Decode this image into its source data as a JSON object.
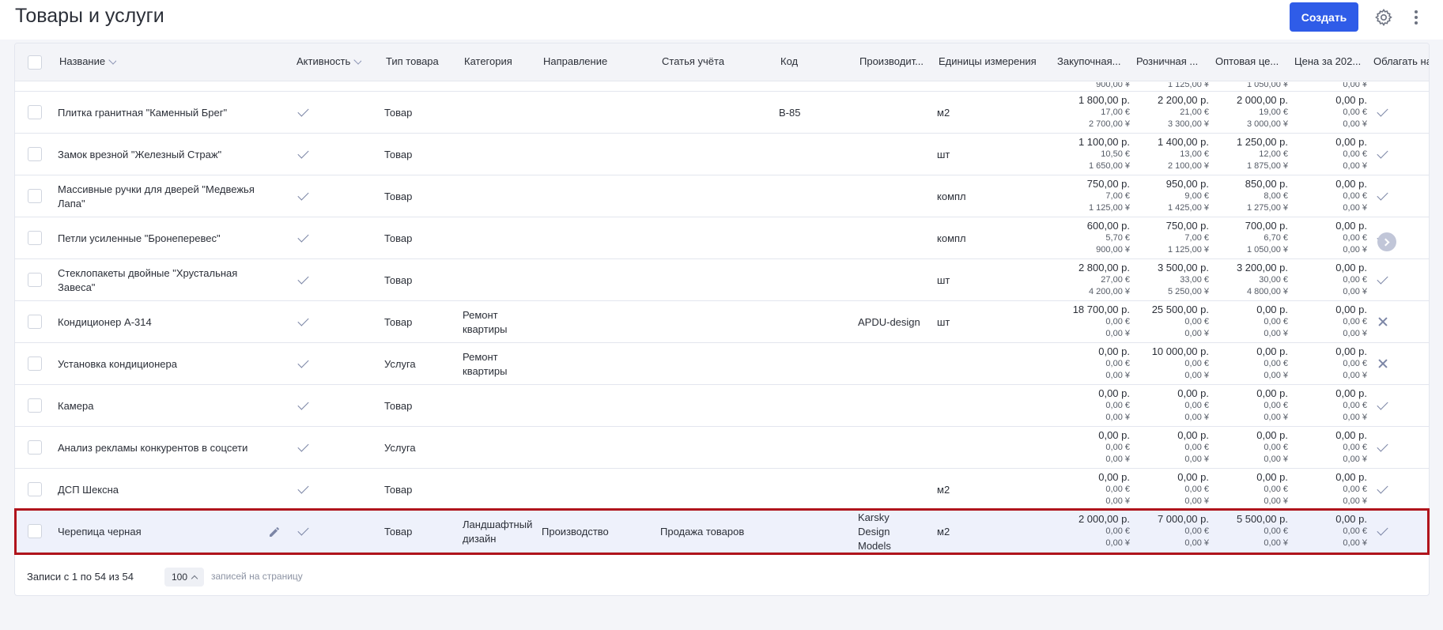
{
  "header": {
    "title": "Товары и услуги",
    "create_label": "Создать"
  },
  "table": {
    "columns": [
      "Название",
      "Активность",
      "Тип товара",
      "Категория",
      "Направление",
      "Статья учёта",
      "Код",
      "Производит...",
      "Единицы измерения",
      "Закупочная...",
      "Розничная ...",
      "Оптовая це...",
      "Цена за 202...",
      "Облагать на"
    ],
    "partial_row": [
      "900,00 ¥",
      "1 125,00 ¥",
      "1 050,00 ¥",
      "0,00 ¥"
    ],
    "rows": [
      {
        "name": [
          "Плитка гранитная \"Каменный Брег\""
        ],
        "type": "Товар",
        "category": [],
        "direction": "",
        "account": "",
        "code": "B-85",
        "maker": [],
        "unit": "м2",
        "prices": [
          [
            "1 800,00 р.",
            "17,00 €",
            "2 700,00 ¥"
          ],
          [
            "2 200,00 р.",
            "21,00 €",
            "3 300,00 ¥"
          ],
          [
            "2 000,00 р.",
            "19,00 €",
            "3 000,00 ¥"
          ],
          [
            "0,00 р.",
            "0,00 €",
            "0,00 ¥"
          ]
        ],
        "tax": "check"
      },
      {
        "name": [
          "Замок врезной \"Железный Страж\""
        ],
        "type": "Товар",
        "category": [],
        "direction": "",
        "account": "",
        "code": "",
        "maker": [],
        "unit": "шт",
        "prices": [
          [
            "1 100,00 р.",
            "10,50 €",
            "1 650,00 ¥"
          ],
          [
            "1 400,00 р.",
            "13,00 €",
            "2 100,00 ¥"
          ],
          [
            "1 250,00 р.",
            "12,00 €",
            "1 875,00 ¥"
          ],
          [
            "0,00 р.",
            "0,00 €",
            "0,00 ¥"
          ]
        ],
        "tax": "check"
      },
      {
        "name": [
          "Массивные ручки для дверей \"Медвежья",
          "Лапа\""
        ],
        "type": "Товар",
        "category": [],
        "direction": "",
        "account": "",
        "code": "",
        "maker": [],
        "unit": "компл",
        "prices": [
          [
            "750,00 р.",
            "7,00 €",
            "1 125,00 ¥"
          ],
          [
            "950,00 р.",
            "9,00 €",
            "1 425,00 ¥"
          ],
          [
            "850,00 р.",
            "8,00 €",
            "1 275,00 ¥"
          ],
          [
            "0,00 р.",
            "0,00 €",
            "0,00 ¥"
          ]
        ],
        "tax": "check"
      },
      {
        "name": [
          "Петли усиленные \"Бронеперевес\""
        ],
        "type": "Товар",
        "category": [],
        "direction": "",
        "account": "",
        "code": "",
        "maker": [],
        "unit": "компл",
        "prices": [
          [
            "600,00 р.",
            "5,70 €",
            "900,00 ¥"
          ],
          [
            "750,00 р.",
            "7,00 €",
            "1 125,00 ¥"
          ],
          [
            "700,00 р.",
            "6,70 €",
            "1 050,00 ¥"
          ],
          [
            "0,00 р.",
            "0,00 €",
            "0,00 ¥"
          ]
        ],
        "tax": "check"
      },
      {
        "name": [
          "Стеклопакеты двойные \"Хрустальная",
          "Завеса\""
        ],
        "type": "Товар",
        "category": [],
        "direction": "",
        "account": "",
        "code": "",
        "maker": [],
        "unit": "шт",
        "prices": [
          [
            "2 800,00 р.",
            "27,00 €",
            "4 200,00 ¥"
          ],
          [
            "3 500,00 р.",
            "33,00 €",
            "5 250,00 ¥"
          ],
          [
            "3 200,00 р.",
            "30,00 €",
            "4 800,00 ¥"
          ],
          [
            "0,00 р.",
            "0,00 €",
            "0,00 ¥"
          ]
        ],
        "tax": "check"
      },
      {
        "name": [
          "Кондиционер А-314"
        ],
        "type": "Товар",
        "category": [
          "Ремонт",
          "квартиры"
        ],
        "direction": "",
        "account": "",
        "code": "",
        "maker": [
          "APDU-design"
        ],
        "unit": "шт",
        "prices": [
          [
            "18 700,00 р.",
            "0,00 €",
            "0,00 ¥"
          ],
          [
            "25 500,00 р.",
            "0,00 €",
            "0,00 ¥"
          ],
          [
            "0,00 р.",
            "0,00 €",
            "0,00 ¥"
          ],
          [
            "0,00 р.",
            "0,00 €",
            "0,00 ¥"
          ]
        ],
        "tax": "cross"
      },
      {
        "name": [
          "Установка кондиционера"
        ],
        "type": "Услуга",
        "category": [
          "Ремонт",
          "квартиры"
        ],
        "direction": "",
        "account": "",
        "code": "",
        "maker": [],
        "unit": "",
        "prices": [
          [
            "0,00 р.",
            "0,00 €",
            "0,00 ¥"
          ],
          [
            "10 000,00 р.",
            "0,00 €",
            "0,00 ¥"
          ],
          [
            "0,00 р.",
            "0,00 €",
            "0,00 ¥"
          ],
          [
            "0,00 р.",
            "0,00 €",
            "0,00 ¥"
          ]
        ],
        "tax": "cross"
      },
      {
        "name": [
          "Камера"
        ],
        "type": "Товар",
        "category": [],
        "direction": "",
        "account": "",
        "code": "",
        "maker": [],
        "unit": "",
        "prices": [
          [
            "0,00 р.",
            "0,00 €",
            "0,00 ¥"
          ],
          [
            "0,00 р.",
            "0,00 €",
            "0,00 ¥"
          ],
          [
            "0,00 р.",
            "0,00 €",
            "0,00 ¥"
          ],
          [
            "0,00 р.",
            "0,00 €",
            "0,00 ¥"
          ]
        ],
        "tax": "check"
      },
      {
        "name": [
          "Анализ рекламы конкурентов в соцсети"
        ],
        "type": "Услуга",
        "category": [],
        "direction": "",
        "account": "",
        "code": "",
        "maker": [],
        "unit": "",
        "prices": [
          [
            "0,00 р.",
            "0,00 €",
            "0,00 ¥"
          ],
          [
            "0,00 р.",
            "0,00 €",
            "0,00 ¥"
          ],
          [
            "0,00 р.",
            "0,00 €",
            "0,00 ¥"
          ],
          [
            "0,00 р.",
            "0,00 €",
            "0,00 ¥"
          ]
        ],
        "tax": "check"
      },
      {
        "name": [
          "ДСП Шексна"
        ],
        "type": "Товар",
        "category": [],
        "direction": "",
        "account": "",
        "code": "",
        "maker": [],
        "unit": "м2",
        "prices": [
          [
            "0,00 р.",
            "0,00 €",
            "0,00 ¥"
          ],
          [
            "0,00 р.",
            "0,00 €",
            "0,00 ¥"
          ],
          [
            "0,00 р.",
            "0,00 €",
            "0,00 ¥"
          ],
          [
            "0,00 р.",
            "0,00 €",
            "0,00 ¥"
          ]
        ],
        "tax": "check"
      },
      {
        "name": [
          "Черепица черная"
        ],
        "type": "Товар",
        "category": [
          "Ландшафтный",
          "дизайн"
        ],
        "direction": "Производство",
        "account": "Продажа товаров",
        "code": "",
        "maker": [
          "Karsky",
          "Design",
          "Models"
        ],
        "unit": "м2",
        "prices": [
          [
            "2 000,00 р.",
            "0,00 €",
            "0,00 ¥"
          ],
          [
            "7 000,00 р.",
            "0,00 €",
            "0,00 ¥"
          ],
          [
            "5 500,00 р.",
            "0,00 €",
            "0,00 ¥"
          ],
          [
            "0,00 р.",
            "0,00 €",
            "0,00 ¥"
          ]
        ],
        "tax": "check",
        "selected": true
      }
    ]
  },
  "footer": {
    "records": "Записи с 1 по 54 из 54",
    "page_size": "100",
    "per_page": "записей на страницу"
  }
}
